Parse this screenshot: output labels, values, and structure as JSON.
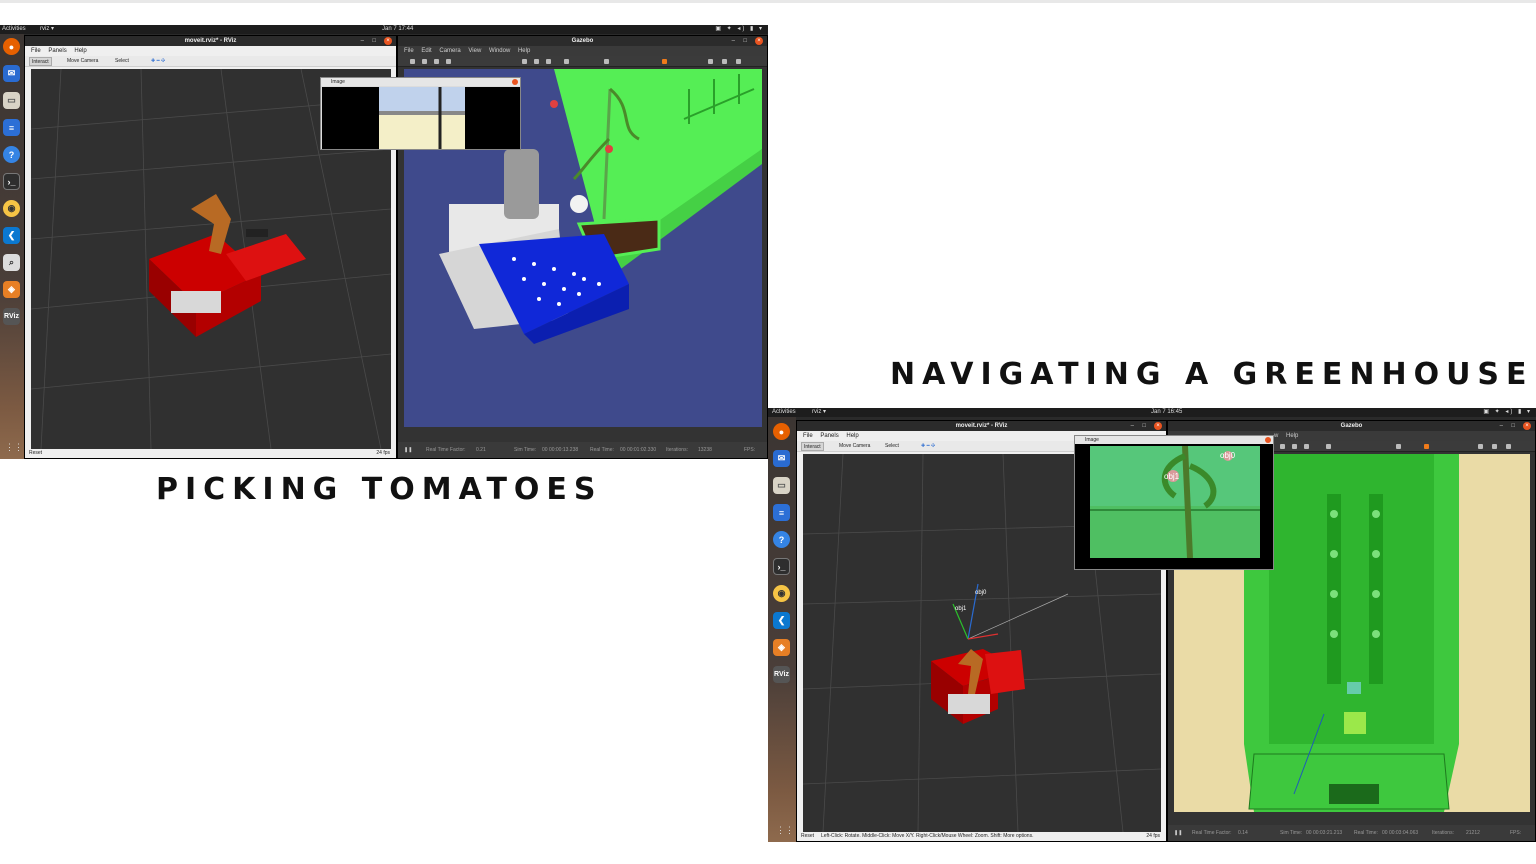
{
  "captions": {
    "picking": "PICKING TOMATOES",
    "navigating": "NAVIGATING A GREENHOUSE"
  },
  "shot1": {
    "topbar": {
      "activities": "Activities",
      "app": "rviz ▾",
      "clock": "Jan 7  17:44"
    },
    "rviz": {
      "title": "moveit.rviz* - RViz",
      "menu": [
        "File",
        "Panels",
        "Help"
      ],
      "tools": [
        "Interact",
        "Move Camera",
        "Select"
      ],
      "status_left": "Reset",
      "fps": "24 fps"
    },
    "image_panel": {
      "title": "Image"
    },
    "gazebo": {
      "title": "Gazebo",
      "menu": [
        "File",
        "Edit",
        "Camera",
        "View",
        "Window",
        "Help"
      ],
      "footer": [
        "Real Time Factor:",
        "0.21",
        "Sim Time:",
        "00 00:00:13.238",
        "Real Time:",
        "00 00:01:02.330",
        "Iterations:",
        "13238",
        "FPS:"
      ]
    }
  },
  "shot2": {
    "topbar": {
      "activities": "Activities",
      "app": "rviz ▾",
      "clock": "Jan 7  16:45"
    },
    "rviz": {
      "title": "moveit.rviz* - RViz",
      "menu": [
        "File",
        "Panels",
        "Help"
      ],
      "tools": [
        "Interact",
        "Move Camera",
        "Select"
      ],
      "status_left": "Reset",
      "status_help": "Left-Click: Rotate. Middle-Click: Move X/Y. Right-Click/Mouse Wheel: Zoom. Shift: More options.",
      "fps": "24 fps",
      "labels": [
        "obj0",
        "obj1"
      ]
    },
    "image_panel": {
      "title": "Image",
      "labels": [
        "obj0",
        "obj1"
      ]
    },
    "gazebo": {
      "title": "Gazebo",
      "menu": [
        "w",
        "Help"
      ],
      "footer": [
        "Real Time Factor:",
        "0.14",
        "Sim Time:",
        "00 00:03:21.213",
        "Real Time:",
        "00 00:03:04.063",
        "Iterations:",
        "21212",
        "FPS:"
      ]
    }
  }
}
